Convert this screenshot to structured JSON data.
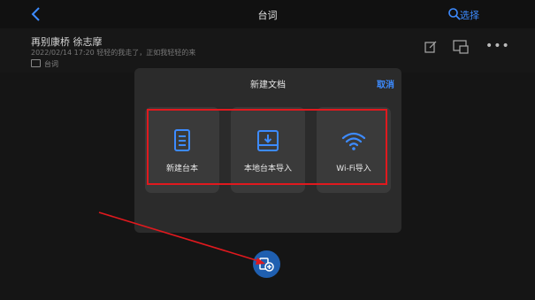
{
  "header": {
    "title": "台词",
    "select_label": "选择"
  },
  "document_item": {
    "title": "再别康桥  徐志摩",
    "meta": "2022/02/14 17:20  轻轻的我走了，正如我轻轻的来",
    "folder": "台词"
  },
  "dialog": {
    "title": "新建文档",
    "cancel_label": "取消",
    "options": [
      {
        "label": "新建台本",
        "icon": "document-icon"
      },
      {
        "label": "本地台本导入",
        "icon": "import-icon"
      },
      {
        "label": "Wi-Fi导入",
        "icon": "wifi-icon"
      }
    ]
  },
  "colors": {
    "accent": "#3d8bff",
    "annotation": "#e0191e",
    "fab": "#1f5fb0"
  }
}
